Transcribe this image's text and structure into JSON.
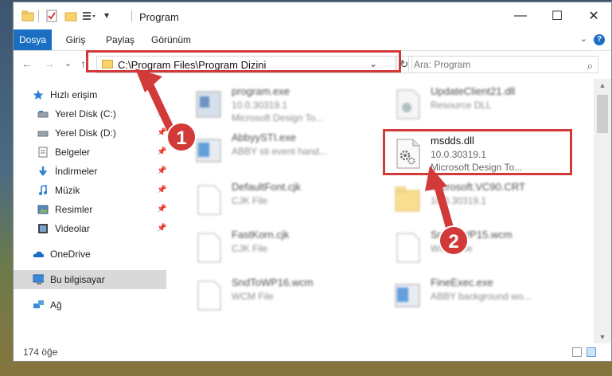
{
  "window": {
    "title": "Program",
    "minimize_glyph": "—",
    "maximize_glyph": "☐",
    "close_glyph": "✕"
  },
  "ribbon": {
    "tabs": [
      {
        "label": "Dosya",
        "active": true
      },
      {
        "label": "Giriş",
        "active": false
      },
      {
        "label": "Paylaş",
        "active": false
      },
      {
        "label": "Görünüm",
        "active": false
      }
    ],
    "help_glyph": "?"
  },
  "nav": {
    "back_glyph": "←",
    "forward_glyph": "→",
    "recent_glyph": "⌄",
    "up_glyph": "↑",
    "address": "C:\\Program Files\\Program Dizini",
    "refresh_glyph": "↻",
    "search_placeholder": "Ara: Program",
    "search_icon": "search-icon"
  },
  "sidebar": {
    "items": [
      {
        "label": "Hızlı erişim",
        "icon": "star-icon",
        "pinned": false,
        "selected": false
      },
      {
        "label": "Yerel Disk (C:)",
        "icon": "drive-icon",
        "pinned": true,
        "selected": false
      },
      {
        "label": "Yerel Disk (D:)",
        "icon": "drive-icon",
        "pinned": true,
        "selected": false
      },
      {
        "label": "Belgeler",
        "icon": "documents-icon",
        "pinned": true,
        "selected": false
      },
      {
        "label": "İndirmeler",
        "icon": "download-icon",
        "pinned": true,
        "selected": false
      },
      {
        "label": "Müzik",
        "icon": "music-icon",
        "pinned": true,
        "selected": false
      },
      {
        "label": "Resimler",
        "icon": "pictures-icon",
        "pinned": true,
        "selected": false
      },
      {
        "label": "Videolar",
        "icon": "videos-icon",
        "pinned": true,
        "selected": false
      },
      {
        "label": "OneDrive",
        "icon": "cloud-icon",
        "pinned": false,
        "selected": false
      },
      {
        "label": "Bu bilgisayar",
        "icon": "computer-icon",
        "pinned": false,
        "selected": true
      },
      {
        "label": "Ağ",
        "icon": "network-icon",
        "pinned": false,
        "selected": false
      }
    ]
  },
  "files": [
    {
      "name": "program.exe",
      "line2": "10.0.30319.1",
      "line3": "Microsoft Design To...",
      "icon": "exe-icon",
      "blurred": true
    },
    {
      "name": "UpdateClient21.dll",
      "line2": "Resource DLL",
      "line3": "",
      "icon": "dll-icon",
      "blurred": true
    },
    {
      "name": "AbbyySTI.exe",
      "line2": "ABBY sti event hand...",
      "line3": "",
      "icon": "exe-icon",
      "blurred": true
    },
    {
      "name": "msdds.dll",
      "line2": "10.0.30319.1",
      "line3": "Microsoft Design To...",
      "icon": "dll-gear-icon",
      "blurred": false
    },
    {
      "name": "DefaultFont.cjk",
      "line2": "CJK File",
      "line3": "",
      "icon": "file-icon",
      "blurred": true
    },
    {
      "name": "Microsoft.VC90.CRT",
      "line2": "10.0.30319.1",
      "line3": "",
      "icon": "folder-icon",
      "blurred": true
    },
    {
      "name": "FastKorn.cjk",
      "line2": "CJK File",
      "line3": "",
      "icon": "file-icon",
      "blurred": true
    },
    {
      "name": "SndToWP15.wcm",
      "line2": "WCM File",
      "line3": "",
      "icon": "file-icon",
      "blurred": true
    },
    {
      "name": "SndToWP16.wcm",
      "line2": "WCM File",
      "line3": "",
      "icon": "file-icon",
      "blurred": true
    },
    {
      "name": "FineExec.exe",
      "line2": "ABBY background wo...",
      "line3": "",
      "icon": "exe-icon",
      "blurred": true
    }
  ],
  "status": {
    "count": "174 öğe"
  },
  "annotations": {
    "step1": "1",
    "step2": "2",
    "color": "#d23a3a"
  }
}
